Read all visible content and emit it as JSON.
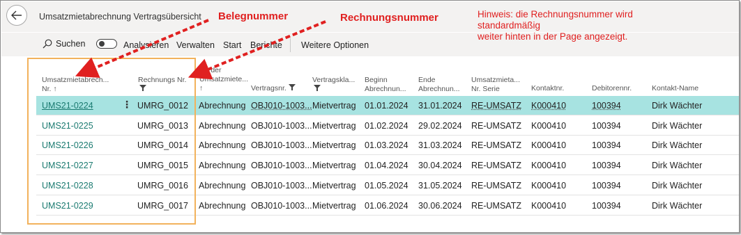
{
  "page": {
    "title": "Umsatzmietabrechnung Vertragsübersicht"
  },
  "annotations": {
    "beleg": "Belegnummer",
    "rechnung": "Rechnungsnummer",
    "hint_line1": "Hinweis: die Rechnungsnummer wird standardmäßig",
    "hint_line2": "weiter hinten in der Page angezeigt.",
    "color": "#e02020"
  },
  "toolbar": {
    "search": "Suchen",
    "analyze": "Analysieren",
    "manage": "Verwalten",
    "start": "Start",
    "reports": "Berichte",
    "more": "Weitere Optionen"
  },
  "columns": {
    "c1_line1": "Umsatzmietabrech...",
    "c1_line2": "Nr. ↑",
    "c2": "Rechnungs Nr.",
    "c3_line1": "Art der",
    "c3_line2": "Umsatzmiete...",
    "c3_line3": "↑",
    "c4": "Vertragsnr.",
    "c5": "Vertragskla...",
    "c6_line1": "Beginn",
    "c6_line2": "Abrechnun...",
    "c7_line1": "Ende",
    "c7_line2": "Abrechnun...",
    "c8_line1": "Umsatzmieta...",
    "c8_line2": "Nr. Serie",
    "c9": "Kontaktnr.",
    "c10": "Debitorennr.",
    "c11": "Kontakt-Name"
  },
  "rows": [
    {
      "nr": "UMS21-0224",
      "rech": "UMRG_0012",
      "art": "Abrechnung",
      "vertrag": "OBJ010-1003...",
      "klasse": "Mietvertrag",
      "beginn": "01.01.2024",
      "ende": "31.01.2024",
      "serie": "RE-UMSATZ",
      "kontakt": "K000410",
      "debitor": "100394",
      "name": "Dirk Wächter"
    },
    {
      "nr": "UMS21-0225",
      "rech": "UMRG_0013",
      "art": "Abrechnung",
      "vertrag": "OBJ010-1003...",
      "klasse": "Mietvertrag",
      "beginn": "01.02.2024",
      "ende": "29.02.2024",
      "serie": "RE-UMSATZ",
      "kontakt": "K000410",
      "debitor": "100394",
      "name": "Dirk Wächter"
    },
    {
      "nr": "UMS21-0226",
      "rech": "UMRG_0014",
      "art": "Abrechnung",
      "vertrag": "OBJ010-1003...",
      "klasse": "Mietvertrag",
      "beginn": "01.03.2024",
      "ende": "31.03.2024",
      "serie": "RE-UMSATZ",
      "kontakt": "K000410",
      "debitor": "100394",
      "name": "Dirk Wächter"
    },
    {
      "nr": "UMS21-0227",
      "rech": "UMRG_0015",
      "art": "Abrechnung",
      "vertrag": "OBJ010-1003...",
      "klasse": "Mietvertrag",
      "beginn": "01.04.2024",
      "ende": "30.04.2024",
      "serie": "RE-UMSATZ",
      "kontakt": "K000410",
      "debitor": "100394",
      "name": "Dirk Wächter"
    },
    {
      "nr": "UMS21-0228",
      "rech": "UMRG_0016",
      "art": "Abrechnung",
      "vertrag": "OBJ010-1003...",
      "klasse": "Mietvertrag",
      "beginn": "01.05.2024",
      "ende": "31.05.2024",
      "serie": "RE-UMSATZ",
      "kontakt": "K000410",
      "debitor": "100394",
      "name": "Dirk Wächter"
    },
    {
      "nr": "UMS21-0229",
      "rech": "UMRG_0017",
      "art": "Abrechnung",
      "vertrag": "OBJ010-1003...",
      "klasse": "Mietvertrag",
      "beginn": "01.06.2024",
      "ende": "30.06.2024",
      "serie": "RE-UMSATZ",
      "kontakt": "K000410",
      "debitor": "100394",
      "name": "Dirk Wächter"
    }
  ],
  "icons": {
    "back": "arrow-left-icon",
    "search": "search-icon",
    "filter": "filter-icon",
    "more": "vertical-ellipsis-icon"
  },
  "colors": {
    "selected_row": "#a7e3e1",
    "link": "#1a7a70",
    "highlight_box": "#f2b25c",
    "header_bg": "#f3f2f1"
  }
}
